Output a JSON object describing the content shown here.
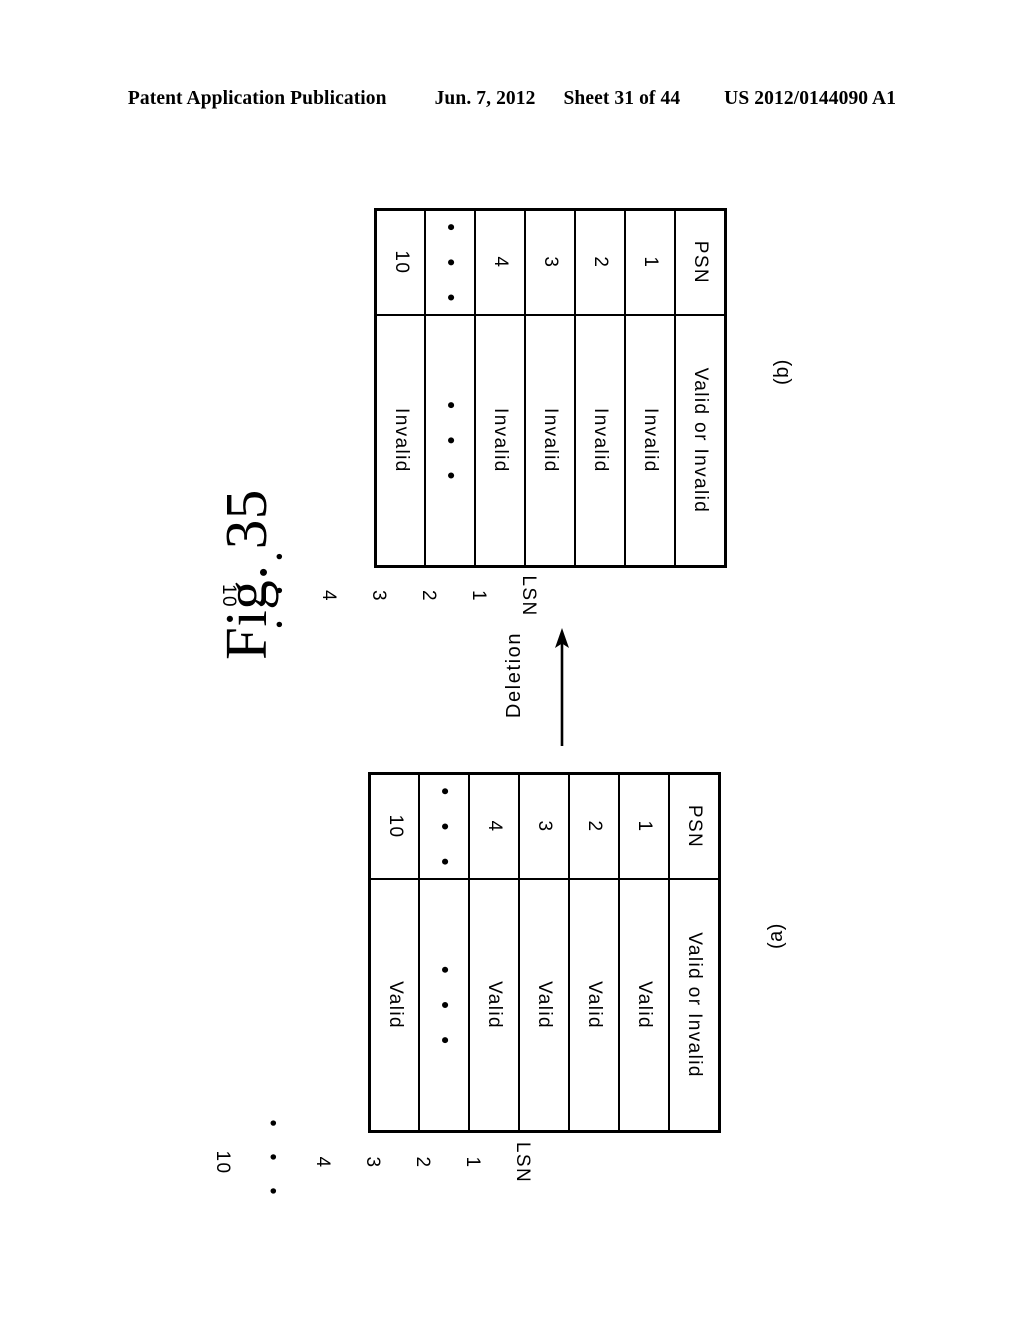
{
  "header": {
    "publication": "Patent Application Publication",
    "date": "Jun. 7, 2012",
    "sheet": "Sheet 31 of 44",
    "patent_number": "US 2012/0144090 A1"
  },
  "figure": {
    "title": "Fig. 35",
    "transition": {
      "label": "Deletion",
      "arrow": "arrow-up",
      "from": "(a)",
      "to": "(b)"
    }
  },
  "tables": {
    "after": {
      "sub_label": "(b)",
      "outside_header": "LSN",
      "columns": [
        "PSN",
        "Valid or Invalid"
      ],
      "outside_values": [
        "1",
        "2",
        "3",
        "4",
        "• • •",
        "10"
      ],
      "rows": [
        {
          "lsn": "1",
          "psn": "1",
          "status": "Invalid"
        },
        {
          "lsn": "2",
          "psn": "2",
          "status": "Invalid"
        },
        {
          "lsn": "3",
          "psn": "3",
          "status": "Invalid"
        },
        {
          "lsn": "4",
          "psn": "4",
          "status": "Invalid"
        },
        {
          "lsn": "• • •",
          "psn": "• • •",
          "status": "• • •"
        },
        {
          "lsn": "10",
          "psn": "10",
          "status": "Invalid"
        }
      ]
    },
    "before": {
      "sub_label": "(a)",
      "outside_header": "LSN",
      "columns": [
        "PSN",
        "Valid or Invalid"
      ],
      "outside_values": [
        "1",
        "2",
        "3",
        "4",
        "• • •",
        "10"
      ],
      "rows": [
        {
          "lsn": "1",
          "psn": "1",
          "status": "Valid"
        },
        {
          "lsn": "2",
          "psn": "2",
          "status": "Valid"
        },
        {
          "lsn": "3",
          "psn": "3",
          "status": "Valid"
        },
        {
          "lsn": "4",
          "psn": "4",
          "status": "Valid"
        },
        {
          "lsn": "• • •",
          "psn": "• • •",
          "status": "• • •"
        },
        {
          "lsn": "10",
          "psn": "10",
          "status": "Valid"
        }
      ]
    }
  },
  "colors": {
    "ink": "#000000",
    "paper": "#ffffff"
  }
}
